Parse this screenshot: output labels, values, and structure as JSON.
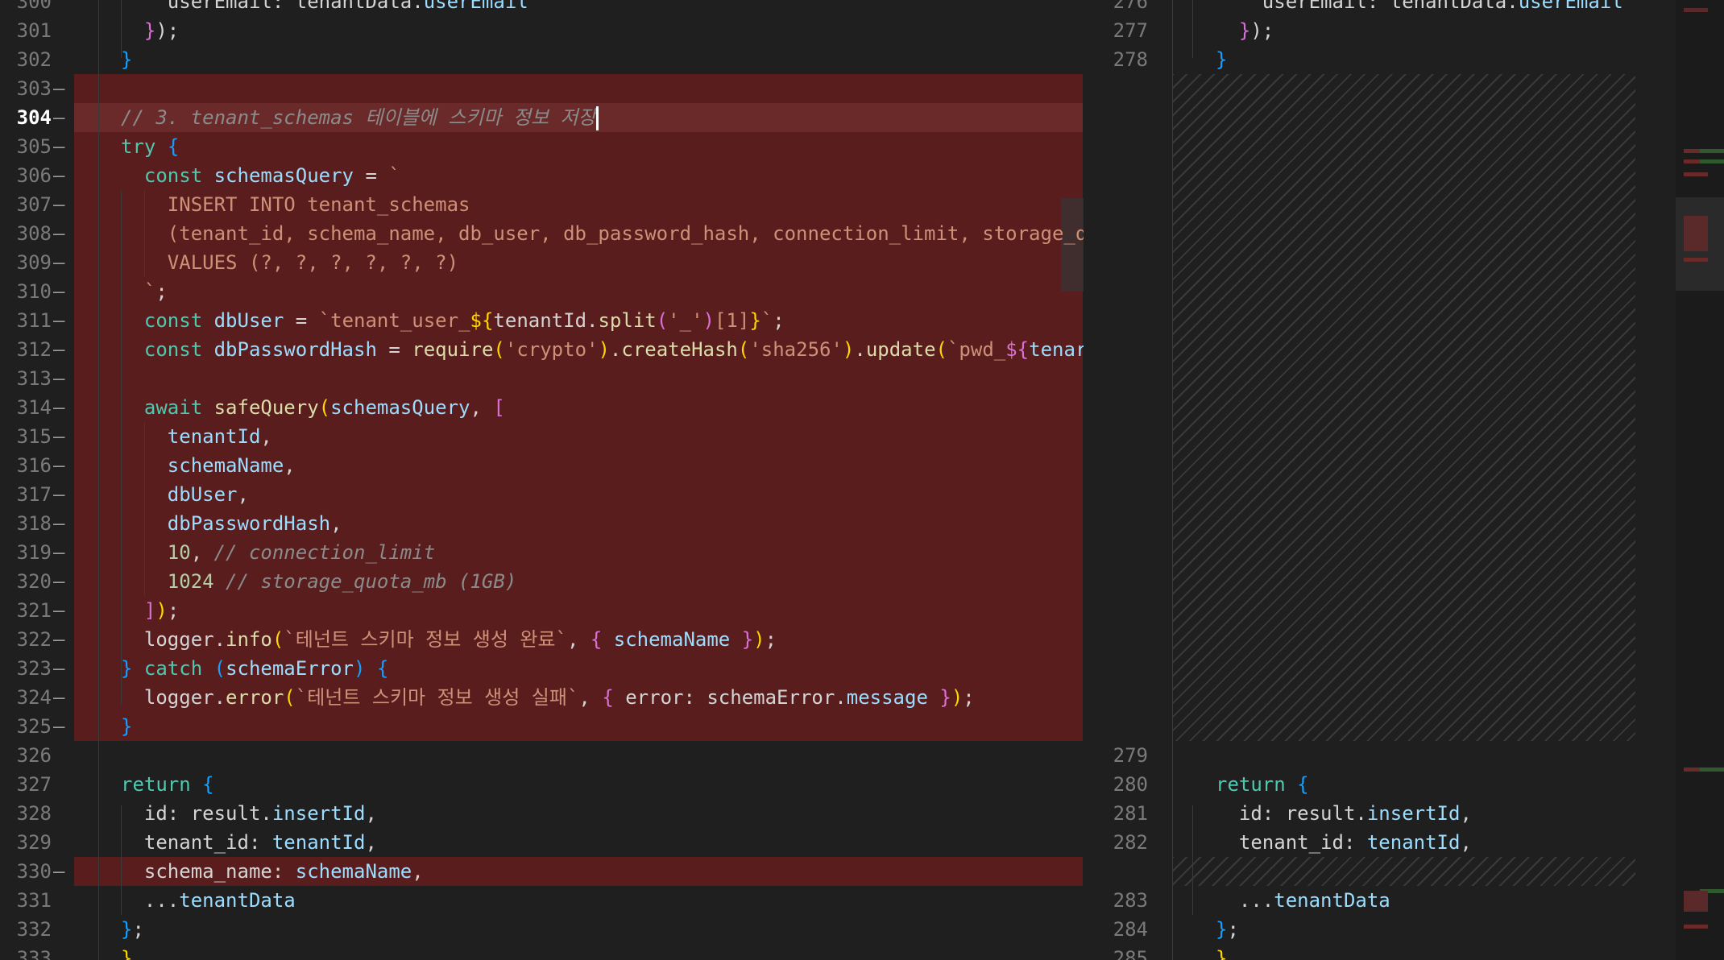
{
  "left": {
    "lines": [
      {
        "no": "300",
        "marker": "",
        "tokens": [
          {
            "t": "    userEmail: tenantData.",
            "c": ""
          },
          {
            "t": "userEmail",
            "c": "prop"
          }
        ]
      },
      {
        "no": "301",
        "marker": "",
        "tokens": [
          {
            "t": "  ",
            "c": ""
          },
          {
            "t": "}",
            "c": "br2"
          },
          {
            "t": ");",
            "c": ""
          }
        ]
      },
      {
        "no": "302",
        "marker": "",
        "tokens": [
          {
            "t": "}",
            "c": "br3"
          }
        ]
      },
      {
        "no": "303",
        "marker": "—",
        "tokens": []
      },
      {
        "no": "304",
        "marker": "—",
        "tokens": [
          {
            "t": "// 3. tenant_schemas 테이블에 스키마 정보 저장",
            "c": "cm"
          }
        ]
      },
      {
        "no": "305",
        "marker": "—",
        "tokens": [
          {
            "t": "try",
            "c": "kwret"
          },
          {
            "t": " ",
            "c": ""
          },
          {
            "t": "{",
            "c": "br3"
          }
        ]
      },
      {
        "no": "306",
        "marker": "—",
        "tokens": [
          {
            "t": "  ",
            "c": ""
          },
          {
            "t": "const",
            "c": "kwret"
          },
          {
            "t": " ",
            "c": ""
          },
          {
            "t": "schemasQuery",
            "c": "var"
          },
          {
            "t": " = ",
            "c": ""
          },
          {
            "t": "`",
            "c": "str"
          }
        ]
      },
      {
        "no": "307",
        "marker": "—",
        "tokens": [
          {
            "t": "    INSERT INTO tenant_schemas",
            "c": "str"
          }
        ]
      },
      {
        "no": "308",
        "marker": "—",
        "tokens": [
          {
            "t": "    (tenant_id, schema_name, db_user, db_password_hash, connection_limit, storage_q",
            "c": "str"
          }
        ]
      },
      {
        "no": "309",
        "marker": "—",
        "tokens": [
          {
            "t": "    VALUES (?, ?, ?, ?, ?, ?)",
            "c": "str"
          }
        ]
      },
      {
        "no": "310",
        "marker": "—",
        "tokens": [
          {
            "t": "  `",
            "c": "str"
          },
          {
            "t": ";",
            "c": ""
          }
        ]
      },
      {
        "no": "311",
        "marker": "—",
        "tokens": [
          {
            "t": "  ",
            "c": ""
          },
          {
            "t": "const",
            "c": "kwret"
          },
          {
            "t": " ",
            "c": ""
          },
          {
            "t": "dbUser",
            "c": "var"
          },
          {
            "t": " = ",
            "c": ""
          },
          {
            "t": "`tenant_user_",
            "c": "str"
          },
          {
            "t": "${",
            "c": "br1"
          },
          {
            "t": "tenantId.",
            "c": ""
          },
          {
            "t": "split",
            "c": "fn"
          },
          {
            "t": "(",
            "c": "br2"
          },
          {
            "t": "'_'",
            "c": "str"
          },
          {
            "t": ")",
            "c": "br2"
          },
          {
            "t": "[1]",
            "c": "str"
          },
          {
            "t": "}",
            "c": "br1"
          },
          {
            "t": "`",
            "c": "str"
          },
          {
            "t": ";",
            "c": ""
          }
        ]
      },
      {
        "no": "312",
        "marker": "—",
        "tokens": [
          {
            "t": "  ",
            "c": ""
          },
          {
            "t": "const",
            "c": "kwret"
          },
          {
            "t": " ",
            "c": ""
          },
          {
            "t": "dbPasswordHash",
            "c": "var"
          },
          {
            "t": " = ",
            "c": ""
          },
          {
            "t": "require",
            "c": "fn"
          },
          {
            "t": "(",
            "c": "br1"
          },
          {
            "t": "'crypto'",
            "c": "str"
          },
          {
            "t": ")",
            "c": "br1"
          },
          {
            "t": ".",
            "c": ""
          },
          {
            "t": "createHash",
            "c": "fn"
          },
          {
            "t": "(",
            "c": "br1"
          },
          {
            "t": "'sha256'",
            "c": "str"
          },
          {
            "t": ")",
            "c": "br1"
          },
          {
            "t": ".",
            "c": ""
          },
          {
            "t": "update",
            "c": "fn"
          },
          {
            "t": "(",
            "c": "br1"
          },
          {
            "t": "`pwd_",
            "c": "str"
          },
          {
            "t": "${",
            "c": "br2"
          },
          {
            "t": "tenar",
            "c": "var"
          }
        ]
      },
      {
        "no": "313",
        "marker": "—",
        "tokens": []
      },
      {
        "no": "314",
        "marker": "—",
        "tokens": [
          {
            "t": "  ",
            "c": ""
          },
          {
            "t": "await",
            "c": "kwret"
          },
          {
            "t": " ",
            "c": ""
          },
          {
            "t": "safeQuery",
            "c": "fn"
          },
          {
            "t": "(",
            "c": "br1"
          },
          {
            "t": "schemasQuery",
            "c": "var"
          },
          {
            "t": ", ",
            "c": ""
          },
          {
            "t": "[",
            "c": "br2"
          }
        ]
      },
      {
        "no": "315",
        "marker": "—",
        "tokens": [
          {
            "t": "    ",
            "c": ""
          },
          {
            "t": "tenantId",
            "c": "var"
          },
          {
            "t": ",",
            "c": ""
          }
        ]
      },
      {
        "no": "316",
        "marker": "—",
        "tokens": [
          {
            "t": "    ",
            "c": ""
          },
          {
            "t": "schemaName",
            "c": "var"
          },
          {
            "t": ",",
            "c": ""
          }
        ]
      },
      {
        "no": "317",
        "marker": "—",
        "tokens": [
          {
            "t": "    ",
            "c": ""
          },
          {
            "t": "dbUser",
            "c": "var"
          },
          {
            "t": ",",
            "c": ""
          }
        ]
      },
      {
        "no": "318",
        "marker": "—",
        "tokens": [
          {
            "t": "    ",
            "c": ""
          },
          {
            "t": "dbPasswordHash",
            "c": "var"
          },
          {
            "t": ",",
            "c": ""
          }
        ]
      },
      {
        "no": "319",
        "marker": "—",
        "tokens": [
          {
            "t": "    ",
            "c": ""
          },
          {
            "t": "10",
            "c": "num"
          },
          {
            "t": ", ",
            "c": ""
          },
          {
            "t": "// connection_limit",
            "c": "cm"
          }
        ]
      },
      {
        "no": "320",
        "marker": "—",
        "tokens": [
          {
            "t": "    ",
            "c": ""
          },
          {
            "t": "1024",
            "c": "num"
          },
          {
            "t": " ",
            "c": ""
          },
          {
            "t": "// storage_quota_mb (1GB)",
            "c": "cm"
          }
        ]
      },
      {
        "no": "321",
        "marker": "—",
        "tokens": [
          {
            "t": "  ",
            "c": ""
          },
          {
            "t": "]",
            "c": "br2"
          },
          {
            "t": ")",
            "c": "br1"
          },
          {
            "t": ";",
            "c": ""
          }
        ]
      },
      {
        "no": "322",
        "marker": "—",
        "tokens": [
          {
            "t": "  logger.",
            "c": ""
          },
          {
            "t": "info",
            "c": "fn"
          },
          {
            "t": "(",
            "c": "br1"
          },
          {
            "t": "`테넌트 스키마 정보 생성 완료`",
            "c": "str"
          },
          {
            "t": ", ",
            "c": ""
          },
          {
            "t": "{",
            "c": "br2"
          },
          {
            "t": " schemaName ",
            "c": "var"
          },
          {
            "t": "}",
            "c": "br2"
          },
          {
            "t": ")",
            "c": "br1"
          },
          {
            "t": ";",
            "c": ""
          }
        ]
      },
      {
        "no": "323",
        "marker": "—",
        "tokens": [
          {
            "t": "}",
            "c": "br3"
          },
          {
            "t": " ",
            "c": ""
          },
          {
            "t": "catch",
            "c": "kwret"
          },
          {
            "t": " ",
            "c": ""
          },
          {
            "t": "(",
            "c": "br3"
          },
          {
            "t": "schemaError",
            "c": "var"
          },
          {
            "t": ")",
            "c": "br3"
          },
          {
            "t": " ",
            "c": ""
          },
          {
            "t": "{",
            "c": "br3"
          }
        ]
      },
      {
        "no": "324",
        "marker": "—",
        "tokens": [
          {
            "t": "  logger.",
            "c": ""
          },
          {
            "t": "error",
            "c": "fn"
          },
          {
            "t": "(",
            "c": "br1"
          },
          {
            "t": "`테넌트 스키마 정보 생성 실패`",
            "c": "str"
          },
          {
            "t": ", ",
            "c": ""
          },
          {
            "t": "{",
            "c": "br2"
          },
          {
            "t": " error: schemaError.",
            "c": ""
          },
          {
            "t": "message",
            "c": "prop"
          },
          {
            "t": " ",
            "c": ""
          },
          {
            "t": "}",
            "c": "br2"
          },
          {
            "t": ")",
            "c": "br1"
          },
          {
            "t": ";",
            "c": ""
          }
        ]
      },
      {
        "no": "325",
        "marker": "—",
        "tokens": [
          {
            "t": "}",
            "c": "br3"
          }
        ]
      },
      {
        "no": "326",
        "marker": "",
        "tokens": []
      },
      {
        "no": "327",
        "marker": "",
        "tokens": [
          {
            "t": "return",
            "c": "kwret"
          },
          {
            "t": " ",
            "c": ""
          },
          {
            "t": "{",
            "c": "br3"
          }
        ]
      },
      {
        "no": "328",
        "marker": "",
        "tokens": [
          {
            "t": "  id: result.",
            "c": ""
          },
          {
            "t": "insertId",
            "c": "prop"
          },
          {
            "t": ",",
            "c": ""
          }
        ]
      },
      {
        "no": "329",
        "marker": "",
        "tokens": [
          {
            "t": "  tenant_id: ",
            "c": ""
          },
          {
            "t": "tenantId",
            "c": "var"
          },
          {
            "t": ",",
            "c": ""
          }
        ]
      },
      {
        "no": "330",
        "marker": "—",
        "tokens": [
          {
            "t": "  schema_name: ",
            "c": ""
          },
          {
            "t": "schemaName",
            "c": "var"
          },
          {
            "t": ",",
            "c": ""
          }
        ]
      },
      {
        "no": "331",
        "marker": "",
        "tokens": [
          {
            "t": "  ...",
            "c": ""
          },
          {
            "t": "tenantData",
            "c": "var"
          }
        ]
      },
      {
        "no": "332",
        "marker": "",
        "tokens": [
          {
            "t": "}",
            "c": "br3"
          },
          {
            "t": ";",
            "c": ""
          }
        ]
      },
      {
        "no": "333",
        "marker": "",
        "tokens": [
          {
            "t": "}",
            "c": "br1"
          }
        ]
      }
    ]
  },
  "right": {
    "lines": [
      {
        "no": "276",
        "tokens": [
          {
            "t": "    userEmail: tenantData.",
            "c": ""
          },
          {
            "t": "userEmail",
            "c": "prop"
          }
        ]
      },
      {
        "no": "277",
        "tokens": [
          {
            "t": "  ",
            "c": ""
          },
          {
            "t": "}",
            "c": "br2"
          },
          {
            "t": ");",
            "c": ""
          }
        ]
      },
      {
        "no": "278",
        "tokens": [
          {
            "t": "}",
            "c": "br3"
          }
        ]
      },
      {
        "no": "279",
        "tokens": []
      },
      {
        "no": "280",
        "tokens": [
          {
            "t": "return",
            "c": "kwret"
          },
          {
            "t": " ",
            "c": ""
          },
          {
            "t": "{",
            "c": "br3"
          }
        ]
      },
      {
        "no": "281",
        "tokens": [
          {
            "t": "  id: result.",
            "c": ""
          },
          {
            "t": "insertId",
            "c": "prop"
          },
          {
            "t": ",",
            "c": ""
          }
        ]
      },
      {
        "no": "282",
        "tokens": [
          {
            "t": "  tenant_id: ",
            "c": ""
          },
          {
            "t": "tenantId",
            "c": "var"
          },
          {
            "t": ",",
            "c": ""
          }
        ]
      },
      {
        "no": "283",
        "tokens": [
          {
            "t": "  ...",
            "c": ""
          },
          {
            "t": "tenantData",
            "c": "var"
          }
        ]
      },
      {
        "no": "284",
        "tokens": [
          {
            "t": "}",
            "c": "br3"
          },
          {
            "t": ";",
            "c": ""
          }
        ]
      },
      {
        "no": "285",
        "tokens": [
          {
            "t": "}",
            "c": "br1"
          }
        ]
      }
    ]
  },
  "active_line": "304"
}
